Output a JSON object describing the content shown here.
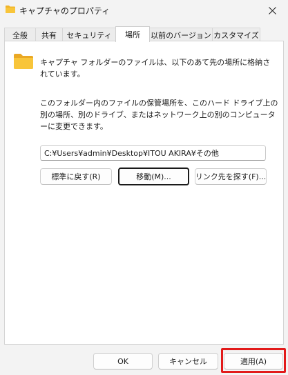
{
  "window": {
    "title": "キャプチャのプロパティ",
    "close_icon": "close-icon",
    "title_icon": "folder-icon"
  },
  "tabs": [
    {
      "label": "全般",
      "active": false
    },
    {
      "label": "共有",
      "active": false
    },
    {
      "label": "セキュリティ",
      "active": false
    },
    {
      "label": "場所",
      "active": true
    },
    {
      "label": "以前のバージョン",
      "active": false
    },
    {
      "label": "カスタマイズ",
      "active": false
    }
  ],
  "location": {
    "description": "キャプチャ フォルダーのファイルは、以下のあて先の場所に格納されています。",
    "move_description": "このフォルダー内のファイルの保管場所を、このハード ドライブ上の別の場所、別のドライブ、またはネットワーク上の別のコンピューターに変更できます。",
    "path_value": "C:¥Users¥admin¥Desktop¥ITOU AKIRA¥その他",
    "restore_label": "標準に戻す(R)",
    "move_label": "移動(M)...",
    "find_target_label": "リンク先を探す(F)..."
  },
  "footer": {
    "ok_label": "OK",
    "cancel_label": "キャンセル",
    "apply_label": "適用(A)"
  },
  "colors": {
    "folder": "#f8c53a",
    "highlight": "#e21a1a"
  }
}
